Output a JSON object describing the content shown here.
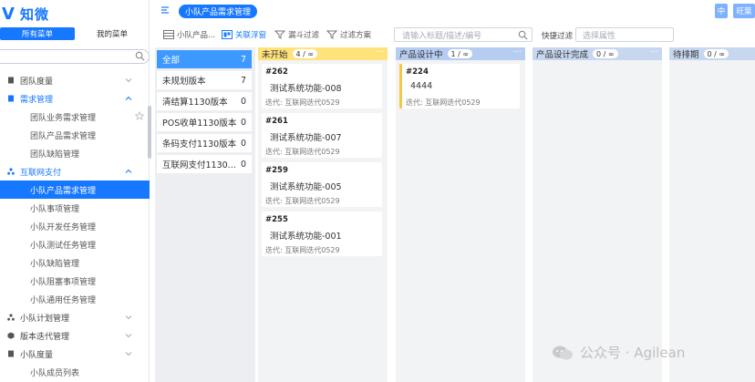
{
  "app": {
    "logo_mark": "V",
    "logo_text": "知微"
  },
  "menu_tabs": [
    {
      "label": "所有菜单",
      "active": true
    },
    {
      "label": "我的菜单",
      "active": false
    }
  ],
  "sidebar": {
    "items": [
      {
        "label": "团队度量",
        "type": "group",
        "icon": "file-icon"
      },
      {
        "label": "需求管理",
        "type": "group-open",
        "icon": "doc-icon"
      },
      {
        "label": "团队业务需求管理",
        "type": "sub"
      },
      {
        "label": "团队产品需求管理",
        "type": "sub"
      },
      {
        "label": "团队缺陷管理",
        "type": "sub"
      },
      {
        "label": "互联网支付",
        "type": "group-open",
        "icon": "org-icon"
      },
      {
        "label": "小队产品需求管理",
        "type": "sub",
        "selected": true
      },
      {
        "label": "小队事项管理",
        "type": "sub"
      },
      {
        "label": "小队开发任务管理",
        "type": "sub"
      },
      {
        "label": "小队测试任务管理",
        "type": "sub"
      },
      {
        "label": "小队缺陷管理",
        "type": "sub"
      },
      {
        "label": "小队阻塞事项管理",
        "type": "sub"
      },
      {
        "label": "小队通用任务管理",
        "type": "sub"
      },
      {
        "label": "小队计划管理",
        "type": "group",
        "icon": "tree-icon"
      },
      {
        "label": "版本迭代管理",
        "type": "group",
        "icon": "box-icon"
      },
      {
        "label": "小队度量",
        "type": "group",
        "icon": "file-icon"
      },
      {
        "label": "小队成员列表",
        "type": "sub"
      }
    ]
  },
  "header": {
    "page_pill": "小队产品需求管理",
    "right_btn_1": "中",
    "right_btn_2": "旺葉"
  },
  "toolbar": {
    "views_label": "小队产品...",
    "kanban_label": "关联浮窗",
    "filter_label": "漏斗过滤",
    "plan_label": "过滤方案",
    "search_placeholder": "请输入标题/描述/编号",
    "quick_filter_label": "快捷过滤",
    "quick_filter_placeholder": "选择属性"
  },
  "versions": [
    {
      "label": "全部",
      "count": "7",
      "selected": true
    },
    {
      "label": "未规划版本",
      "count": "7"
    },
    {
      "label": "清结算1130版本",
      "count": "0"
    },
    {
      "label": "POS收单1130版本",
      "count": "0"
    },
    {
      "label": "条码支付1130版本",
      "count": "0"
    },
    {
      "label": "互联网支付1130...",
      "count": "0"
    }
  ],
  "columns": [
    {
      "title": "未开始",
      "count": "4 / ∞",
      "color": "#ffe27a",
      "cards": [
        {
          "id": "#262",
          "title": "测试系统功能-008",
          "iteration": "迭代: 互联网迭代0529"
        },
        {
          "id": "#261",
          "title": "测试系统功能-007",
          "iteration": "迭代: 互联网迭代0529"
        },
        {
          "id": "#259",
          "title": "测试系统功能-005",
          "iteration": "迭代: 互联网迭代0529"
        },
        {
          "id": "#255",
          "title": "测试系统功能-001",
          "iteration": "迭代: 互联网迭代0529"
        }
      ]
    },
    {
      "title": "产品设计中",
      "count": "1 / ∞",
      "color": "#b6cdf2",
      "cards": [
        {
          "id": "#224",
          "title": "4444",
          "iteration": "迭代: 互联网迭代0529"
        }
      ]
    },
    {
      "title": "产品设计完成",
      "count": "0 / ∞",
      "color": "#c8d7f0",
      "cards": []
    },
    {
      "title": "待排期",
      "count": "0 / ∞",
      "color": "#c8d7f0",
      "cards": []
    }
  ],
  "watermark": {
    "text": "公众号 · Agilean"
  }
}
